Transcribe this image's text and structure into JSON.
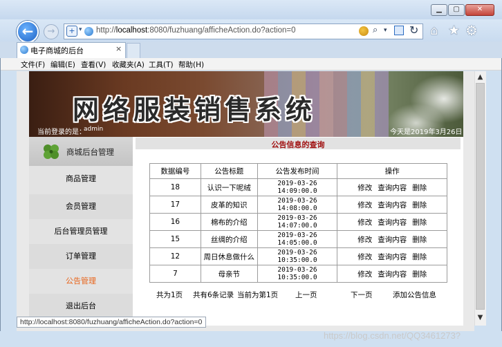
{
  "browser": {
    "url_prefix": "http://",
    "url_host": "localhost",
    "url_rest": ":8080/fuzhuang/afficheAction.do?action=0",
    "tab_title": "电子商城的后台",
    "tab_close": "×",
    "menu": [
      "文件(F)",
      "编辑(E)",
      "查看(V)",
      "收藏夹(A)",
      "工具(T)",
      "帮助(H)"
    ],
    "status_url": "http://localhost:8080/fuzhuang/afficheAction.do?action=0",
    "watermark": "https://blog.csdn.net/QQ3461273?"
  },
  "banner": {
    "title": "网络服装销售系统",
    "login_label": "当前登录的是：",
    "login_user": "admin",
    "date_text": "今天是2019年3月26日"
  },
  "sidebar": {
    "title": "商城后台管理",
    "items": [
      "商品管理",
      "会员管理",
      "后台管理员管理",
      "订单管理",
      "公告管理",
      "退出后台"
    ]
  },
  "content": {
    "title": "公告信息的查询",
    "columns": [
      "数据编号",
      "公告标题",
      "公告发布时间",
      "操作"
    ],
    "rows": [
      {
        "id": "18",
        "title": "认识一下呢绒",
        "time": "2019-03-26 14:09:00.0"
      },
      {
        "id": "17",
        "title": "皮革的知识",
        "time": "2019-03-26 14:08:00.0"
      },
      {
        "id": "16",
        "title": "棉布的介绍",
        "time": "2019-03-26 14:07:00.0"
      },
      {
        "id": "15",
        "title": "丝绸的介绍",
        "time": "2019-03-26 14:05:00.0"
      },
      {
        "id": "12",
        "title": "周日休息做什么",
        "time": "2019-03-26 10:35:00.0"
      },
      {
        "id": "7",
        "title": "母亲节",
        "time": "2019-03-26 10:35:00.0"
      }
    ],
    "ops": [
      "修改",
      "查询内容",
      "删除"
    ],
    "pager": {
      "total_pages": "共为1页",
      "total_records": "共有6条记录",
      "current_page": "当前为第1页",
      "prev": "上一页",
      "next": "下一页",
      "add": "添加公告信息"
    }
  }
}
